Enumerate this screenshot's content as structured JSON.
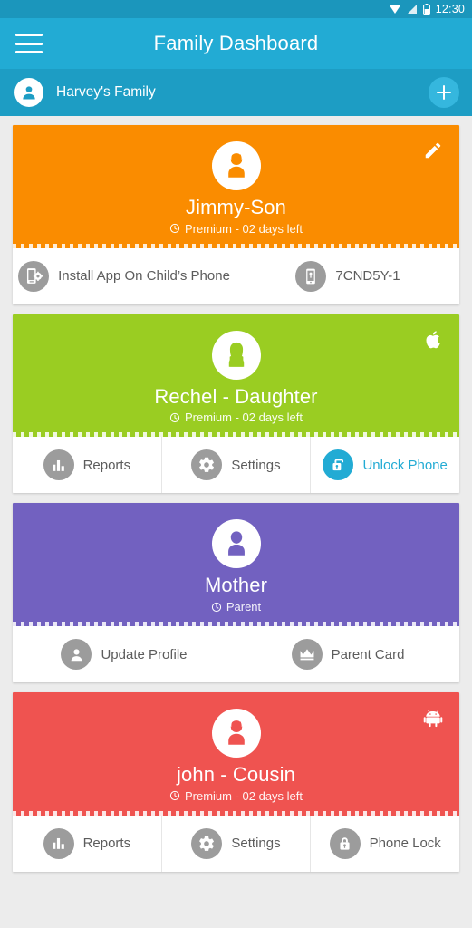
{
  "statusbar": {
    "time": "12:30",
    "icons": [
      "wifi-icon",
      "signal-icon",
      "battery-icon"
    ]
  },
  "toolbar": {
    "menu_icon": "hamburger-menu-icon",
    "title": "Family Dashboard",
    "background": "#22ABD4"
  },
  "family_bar": {
    "avatar_icon": "person-avatar-icon",
    "name": "Harvey's Family",
    "add_label": "+",
    "add_icon": "plus-icon",
    "background": "#1D9DC4"
  },
  "accent_color": "#22ABD4",
  "cards": [
    {
      "name": "Jimmy-Son",
      "status": "Premium - 02 days left",
      "status_icon": "clock-icon",
      "color": "#FA8C00",
      "avatar_icon": "boy-avatar-icon",
      "corner_icon": "edit-pencil-icon",
      "actions": [
        {
          "label": "Install App On Child’s Phone",
          "icon": "phone-setup-icon",
          "accent": false
        },
        {
          "label": "7CND5Y-1",
          "icon": "device-id-icon",
          "accent": false
        }
      ]
    },
    {
      "name": "Rechel - Daughter",
      "status": "Premium - 02 days left",
      "status_icon": "clock-icon",
      "color": "#9ACD22",
      "avatar_icon": "girl-avatar-icon",
      "corner_icon": "apple-logo-icon",
      "actions": [
        {
          "label": "Reports",
          "icon": "bar-chart-icon",
          "accent": false
        },
        {
          "label": "Settings",
          "icon": "gear-icon",
          "accent": false
        },
        {
          "label": "Unlock Phone",
          "icon": "unlock-padlock-icon",
          "accent": true
        }
      ]
    },
    {
      "name": "Mother",
      "status": "Parent",
      "status_icon": "clock-icon",
      "color": "#7261C0",
      "avatar_icon": "woman-avatar-icon",
      "corner_icon": null,
      "actions": [
        {
          "label": "Update Profile",
          "icon": "person-icon",
          "accent": false
        },
        {
          "label": "Parent Card",
          "icon": "crown-icon",
          "accent": false
        }
      ]
    },
    {
      "name": "john - Cousin",
      "status": "Premium - 02 days left",
      "status_icon": "clock-icon",
      "color": "#EF5350",
      "avatar_icon": "boy-avatar-icon",
      "corner_icon": "android-robot-icon",
      "actions": [
        {
          "label": "Reports",
          "icon": "bar-chart-icon",
          "accent": false
        },
        {
          "label": "Settings",
          "icon": "gear-icon",
          "accent": false
        },
        {
          "label": "Phone Lock",
          "icon": "locked-padlock-icon",
          "accent": false
        }
      ]
    }
  ]
}
